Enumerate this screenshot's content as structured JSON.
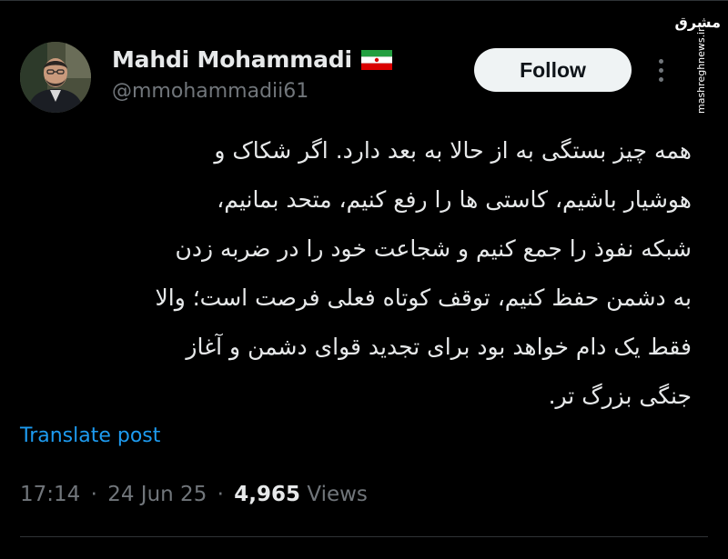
{
  "author": {
    "display_name": "Mahdi Mohammadi",
    "handle": "@mmohammadii61",
    "flag_icon": "iran-flag-icon"
  },
  "actions": {
    "follow_label": "Follow",
    "more_icon": "more-vertical-icon"
  },
  "tweet": {
    "lines": [
      "همه چیز بستگی به از حالا به بعد دارد. اگر شکاک و",
      "هوشیار باشیم، کاستی ها را رفع کنیم، متحد بمانیم،",
      "شبکه نفوذ را جمع کنیم و شجاعت خود را در ضربه زدن",
      "به دشمن حفظ کنیم، توقف کوتاه فعلی فرصت است؛ والا",
      "فقط یک دام خواهد بود برای تجدید قوای دشمن و آغاز",
      "جنگی بزرگ تر."
    ],
    "translate_label": "Translate post"
  },
  "meta": {
    "time": "17:14",
    "date": "24 Jun 25",
    "separator": "·",
    "views_count": "4,965",
    "views_label": "Views"
  },
  "watermark": {
    "logo": "مشرق",
    "url": "mashreghnews.ir"
  },
  "colors": {
    "background": "#000000",
    "text_primary": "#e7e9ea",
    "text_secondary": "#71767b",
    "link": "#1d9bf0",
    "follow_bg": "#eff3f4"
  }
}
